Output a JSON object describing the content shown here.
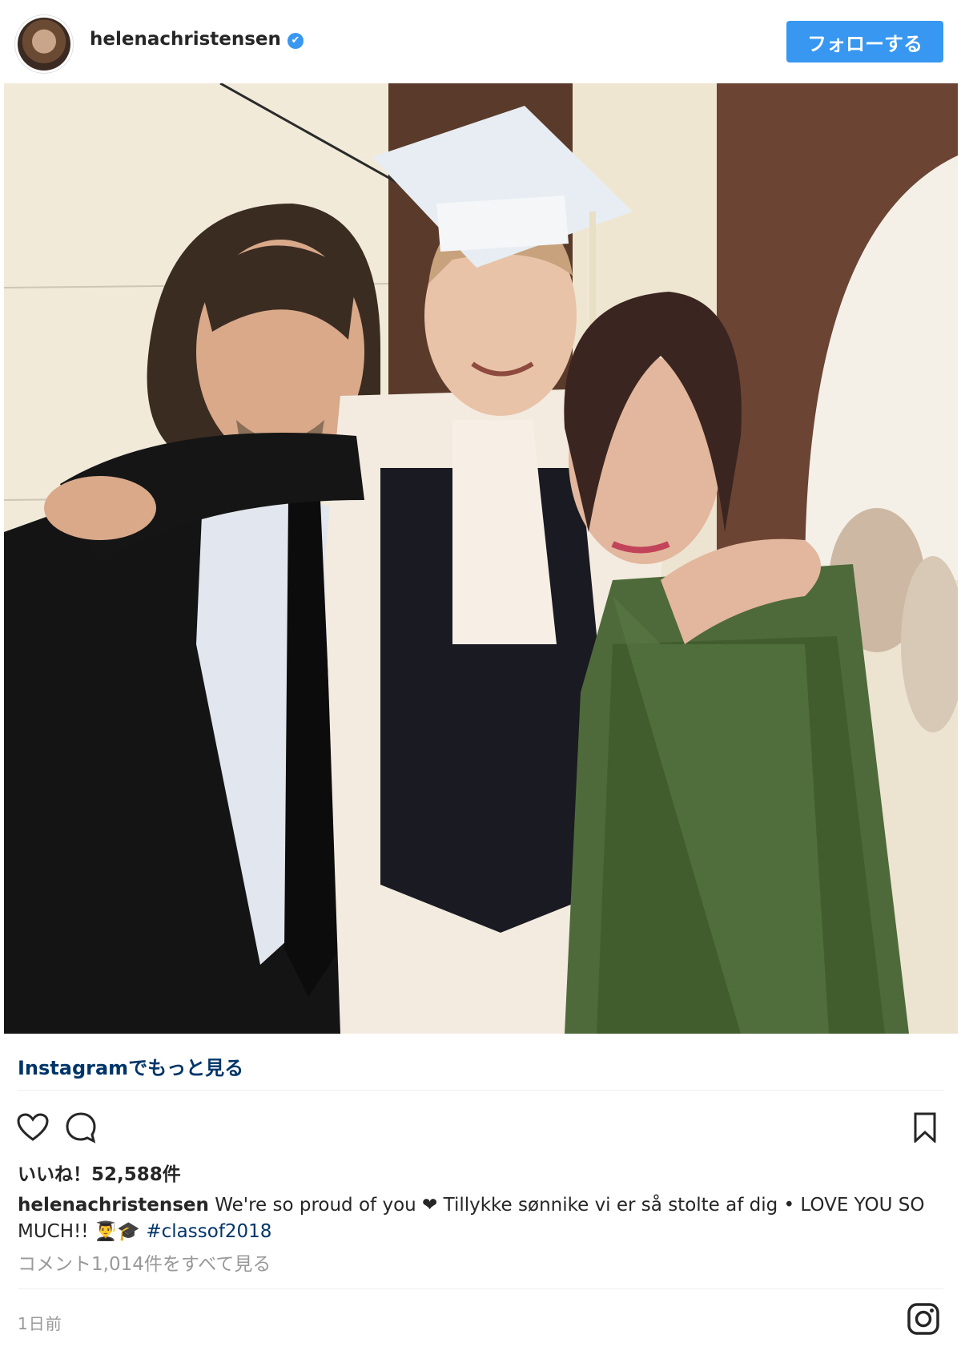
{
  "header": {
    "username": "helenachristensen",
    "verified_icon": "✔",
    "follow_label": "フォローする"
  },
  "post": {
    "more_link": "Instagramでもっと見る",
    "likes": "いいね！52,588件",
    "caption_user": "helenachristensen",
    "caption_text": " We're so proud of you ❤ Tillykke sønnike vi er så stolte af dig • LOVE YOU SO MUCH!! 👨‍🎓🎓 ",
    "caption_tag": "#classof2018",
    "view_comments": "コメント1,014件をすべて見る",
    "time": "1日前"
  },
  "icons": {
    "like": "heart-icon",
    "comment": "comment-icon",
    "save": "bookmark-icon",
    "logo": "instagram-icon"
  },
  "colors": {
    "follow_button": "#3897f0",
    "link": "#003569",
    "muted": "#999999"
  }
}
